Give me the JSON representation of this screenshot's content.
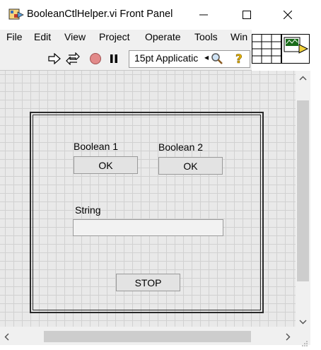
{
  "window": {
    "title": "BooleanCtlHelper.vi Front Panel",
    "minimize_glyph": "—",
    "maximize_glyph": "☐",
    "close_glyph": "✕"
  },
  "menu": {
    "items": [
      "File",
      "Edit",
      "View",
      "Project",
      "Operate",
      "Tools",
      "Win"
    ]
  },
  "toolbar": {
    "font_combo_value": "15pt Applicatic",
    "font_combo_arrow": "◂"
  },
  "panel": {
    "boolean1": {
      "label": "Boolean 1",
      "button_text": "OK"
    },
    "boolean2": {
      "label": "Boolean 2",
      "button_text": "OK"
    },
    "string": {
      "label": "String",
      "value": ""
    },
    "stop_button_text": "STOP"
  },
  "scroll": {
    "up_arrow": "︿",
    "down_arrow": "﹀",
    "left_arrow": "‹",
    "right_arrow": "›"
  },
  "colors": {
    "panel_bg": "#e9e9e9",
    "grid_line": "#d1d1d1",
    "chrome_bg": "#f0f0f0",
    "button_face": "#e3e3e3"
  }
}
